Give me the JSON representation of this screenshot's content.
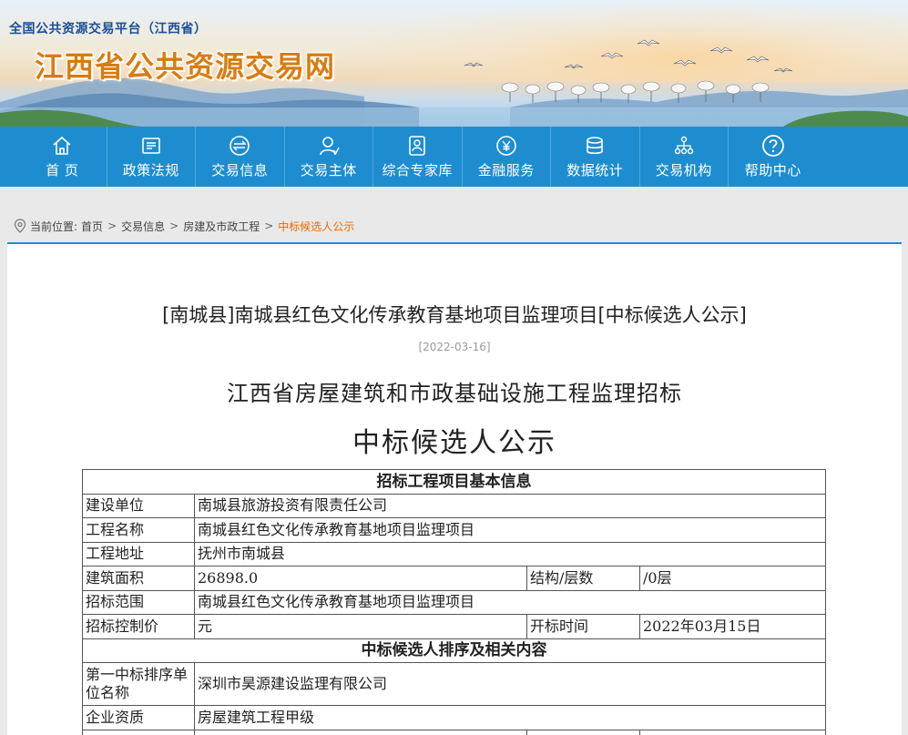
{
  "header": {
    "portal_title": "全国公共资源交易平台（江西省）",
    "site_title": "江西省公共资源交易网"
  },
  "nav": {
    "items": [
      {
        "label": "首 页",
        "icon": "home-icon"
      },
      {
        "label": "政策法规",
        "icon": "document-list-icon"
      },
      {
        "label": "交易信息",
        "icon": "exchange-icon"
      },
      {
        "label": "交易主体",
        "icon": "user-icon"
      },
      {
        "label": "综合专家库",
        "icon": "id-card-icon"
      },
      {
        "label": "金融服务",
        "icon": "yuan-coin-icon"
      },
      {
        "label": "数据统计",
        "icon": "database-icon"
      },
      {
        "label": "交易机构",
        "icon": "org-chart-icon"
      },
      {
        "label": "帮助中心",
        "icon": "question-icon"
      }
    ],
    "colors": {
      "background": "#1d8dd0",
      "divider": "#4fa9de"
    }
  },
  "breadcrumb": {
    "prefix": "当前位置:",
    "items": [
      "首页",
      "交易信息",
      "房建及市政工程"
    ],
    "current": "中标候选人公示",
    "separator": ">",
    "current_color": "#e96a00"
  },
  "article": {
    "title": "[南城县]南城县红色文化传承教育基地项目监理项目[中标候选人公示]",
    "date": "[2022-03-16]",
    "heading_line1": "江西省房屋建筑和市政基础设施工程监理招标",
    "heading_line2": "中标候选人公示"
  },
  "table": {
    "section1_title": "招标工程项目基本信息",
    "builder_label": "建设单位",
    "builder_value": "南城县旅游投资有限责任公司",
    "project_name_label": "工程名称",
    "project_name_value": "南城县红色文化传承教育基地项目监理项目",
    "address_label": "工程地址",
    "address_value": "抚州市南城县",
    "area_label": "建筑面积",
    "area_value": "26898.0",
    "structure_label": "结构/层数",
    "structure_value": "/0层",
    "scope_label": "招标范围",
    "scope_value": "南城县红色文化传承教育基地项目监理项目",
    "price_label": "招标控制价",
    "price_value": "元",
    "open_time_label": "开标时间",
    "open_time_value": "2022年03月15日",
    "section2_title": "中标候选人排序及相关内容",
    "first_candidate_label": "第一中标排序单位名称",
    "first_candidate_value": "深圳市昊源建设监理有限公司",
    "qualification_label": "企业资质",
    "qualification_value": "房屋建筑工程甲级"
  }
}
